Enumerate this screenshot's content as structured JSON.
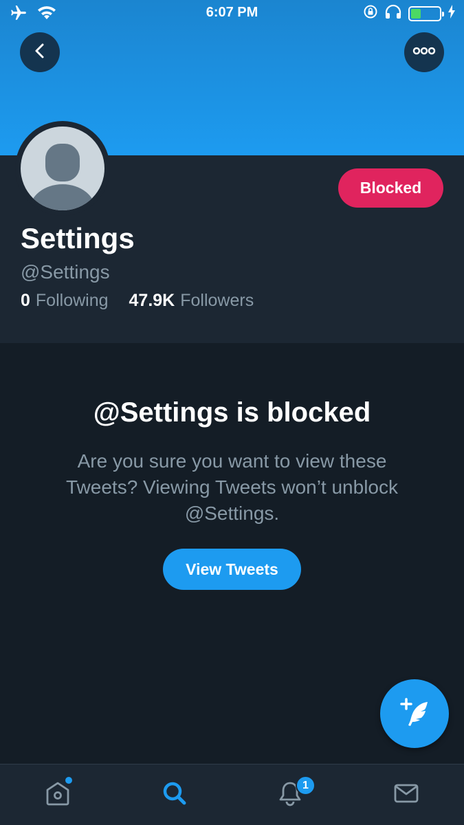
{
  "status_bar": {
    "time": "6:07 PM",
    "icons": [
      "airplane-icon",
      "wifi-icon",
      "rotation-lock-icon",
      "headphones-icon",
      "battery-icon",
      "charging-icon"
    ],
    "battery_level": 0.35,
    "battery_color": "#4cd964"
  },
  "header": {
    "back_icon": "chevron-left-icon",
    "more_icon": "more-horizontal-icon"
  },
  "profile": {
    "display_name": "Settings",
    "handle": "@Settings",
    "following_count": "0",
    "following_label": "Following",
    "followers_count": "47.9K",
    "followers_label": "Followers",
    "blocked_button": "Blocked"
  },
  "blocked_notice": {
    "title": "@Settings is blocked",
    "message": "Are you sure you want to view these Tweets? Viewing Tweets won’t unblock @Settings.",
    "view_button": "View Tweets"
  },
  "fab": {
    "icon": "compose-tweet-icon"
  },
  "tab_bar": {
    "tabs": [
      {
        "name": "home",
        "icon": "home-icon",
        "has_dot": true
      },
      {
        "name": "search",
        "icon": "search-icon",
        "active": true
      },
      {
        "name": "notifications",
        "icon": "bell-icon",
        "badge": "1"
      },
      {
        "name": "messages",
        "icon": "mail-icon"
      }
    ]
  },
  "colors": {
    "accent": "#1d9bf0",
    "blocked": "#e0245e",
    "background": "#141d26",
    "surface": "#1c2733",
    "muted_text": "#8899a6"
  }
}
